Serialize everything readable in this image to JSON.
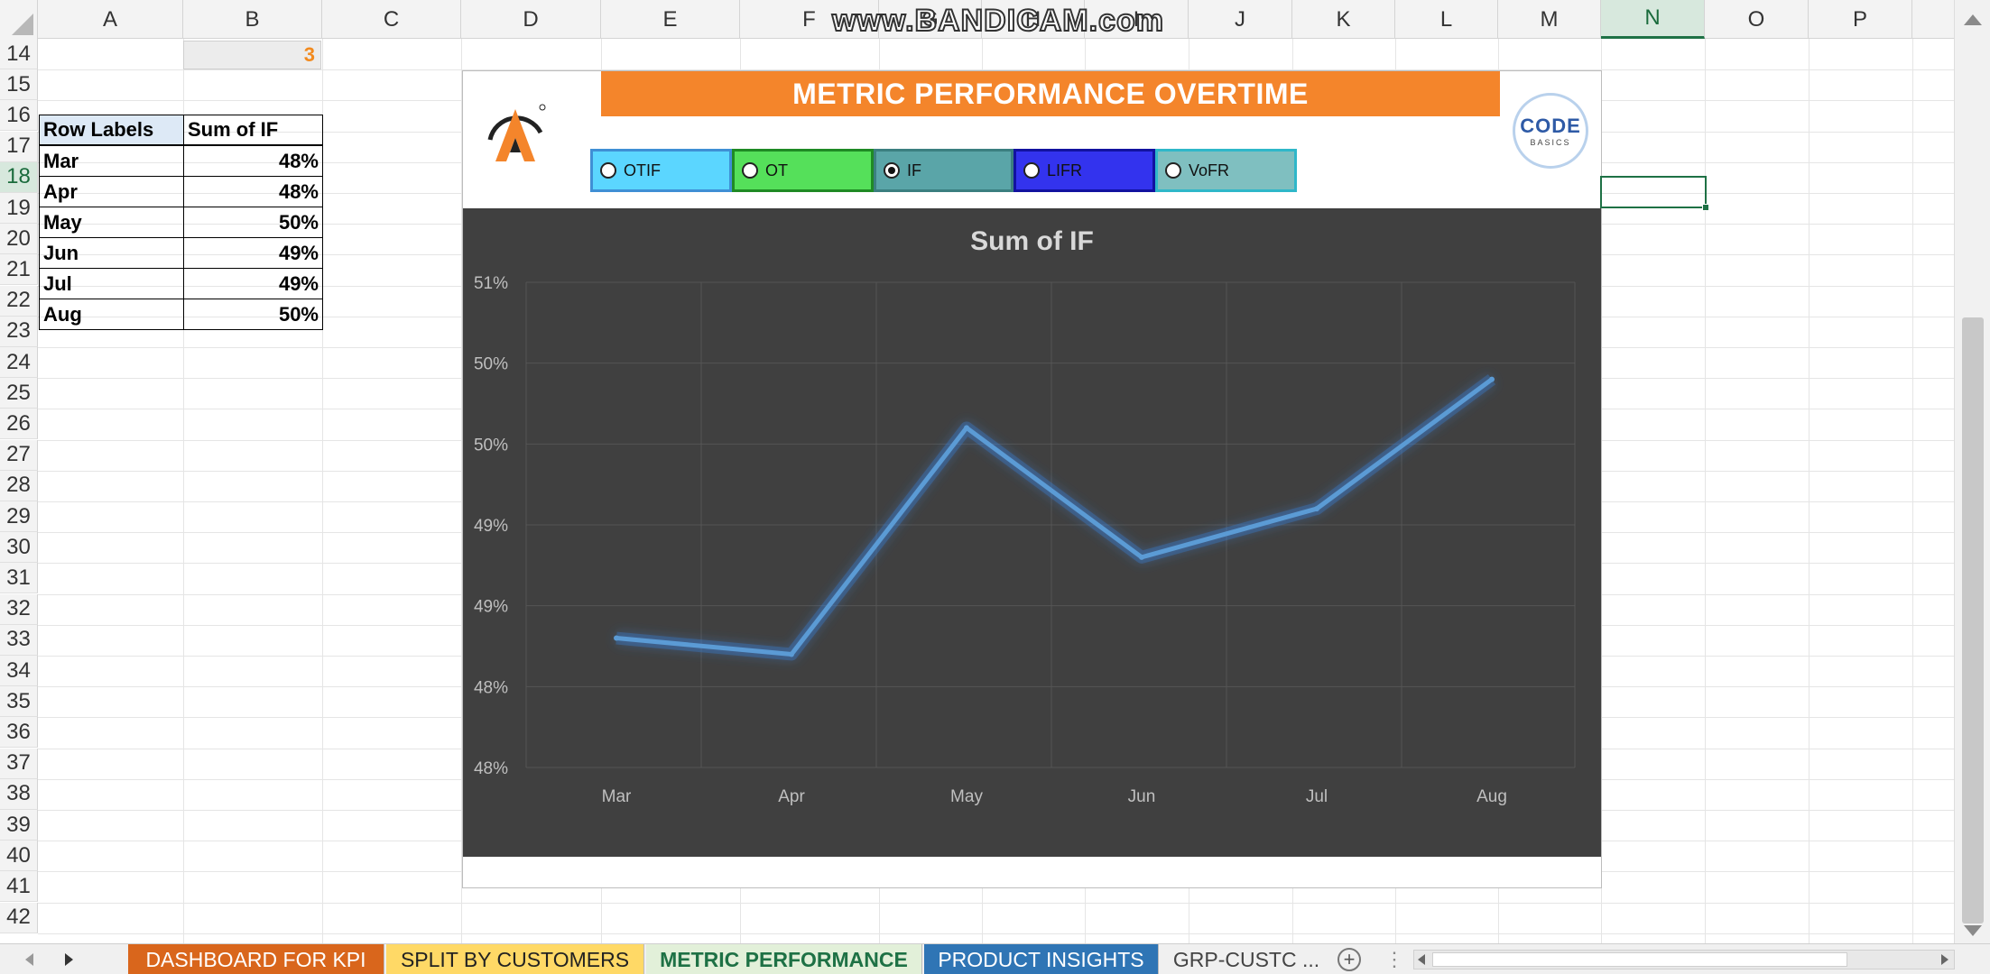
{
  "columns": [
    "A",
    "B",
    "C",
    "D",
    "E",
    "F",
    "G",
    "H",
    "I",
    "J",
    "K",
    "L",
    "M",
    "N",
    "O",
    "P"
  ],
  "selected_column": "N",
  "rows": [
    "14",
    "15",
    "16",
    "17",
    "18",
    "19",
    "20",
    "21",
    "22",
    "23",
    "24",
    "25",
    "26",
    "27",
    "28",
    "29",
    "30",
    "31",
    "32",
    "33",
    "34",
    "35",
    "36",
    "37",
    "38",
    "39",
    "40",
    "41",
    "42"
  ],
  "selected_row": "18",
  "b14_value": "3",
  "pivot": {
    "header": [
      "Row Labels",
      "Sum of IF"
    ],
    "rows": [
      {
        "label": "Mar",
        "value": "48%"
      },
      {
        "label": "Apr",
        "value": "48%"
      },
      {
        "label": "May",
        "value": "50%"
      },
      {
        "label": "Jun",
        "value": "49%"
      },
      {
        "label": "Jul",
        "value": "49%"
      },
      {
        "label": "Aug",
        "value": "50%"
      }
    ]
  },
  "dashboard": {
    "title": "METRIC PERFORMANCE OVERTIME",
    "logo_right_big": "CODE",
    "logo_right_small": "BASICS",
    "options": [
      {
        "label": "OTIF",
        "selected": false,
        "bg": "#5bd6ff"
      },
      {
        "label": "OT",
        "selected": false,
        "bg": "#55e05a"
      },
      {
        "label": "IF",
        "selected": true,
        "bg": "#5aa5a8"
      },
      {
        "label": "LIFR",
        "selected": false,
        "bg": "#3333ee"
      },
      {
        "label": "VoFR",
        "selected": false,
        "bg": "#7fbfc0"
      }
    ]
  },
  "chart_data": {
    "type": "line",
    "title": "Sum of IF",
    "categories": [
      "Mar",
      "Apr",
      "May",
      "Jun",
      "Jul",
      "Aug"
    ],
    "values": [
      48.6,
      48.5,
      49.9,
      49.1,
      49.4,
      50.2
    ],
    "y_tick_labels": [
      "48%",
      "48%",
      "49%",
      "49%",
      "50%",
      "50%",
      "51%"
    ],
    "ylim": [
      47.8,
      50.8
    ],
    "grid": true,
    "line_color": "#5b9bd5"
  },
  "watermark": "www.BANDICAM.com",
  "sheet_tabs": [
    {
      "label": "DASHBOARD FOR KPI",
      "bg": "#d9661c",
      "color": "#ffffff"
    },
    {
      "label": "SPLIT BY CUSTOMERS",
      "bg": "#ffd966",
      "color": "#222222"
    },
    {
      "label": "METRIC PERFORMANCE",
      "bg": "#e2f0d9",
      "color": "#1e7145"
    },
    {
      "label": "PRODUCT INSIGHTS",
      "bg": "#2f75b5",
      "color": "#ffffff"
    },
    {
      "label": "GRP-CUSTC ...",
      "bg": "#f0f0f0",
      "color": "#444444"
    }
  ],
  "add_sheet_symbol": "+",
  "tab_dots": "⋮"
}
